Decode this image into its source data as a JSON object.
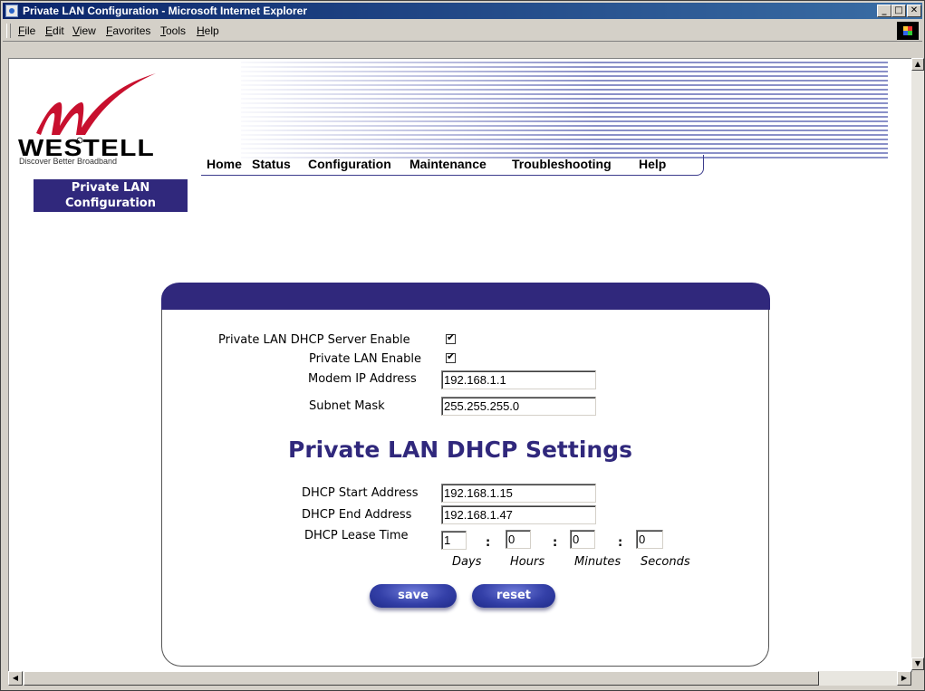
{
  "window": {
    "title": "Private LAN Configuration - Microsoft Internet Explorer",
    "controls": {
      "minimize": "_",
      "maximize": "□",
      "close": "✕"
    }
  },
  "menu": {
    "file": "File",
    "edit": "Edit",
    "view": "View",
    "favorites": "Favorites",
    "tools": "Tools",
    "help": "Help"
  },
  "header": {
    "brand": "WESTELL",
    "tagline": "Discover Better Broadband",
    "section_line1": "Private LAN",
    "section_line2": "Configuration"
  },
  "nav": [
    "Home",
    "Status",
    "Configuration",
    "Maintenance",
    "Troubleshooting",
    "Help"
  ],
  "form": {
    "dhcp_server_enable_label": "Private LAN DHCP Server Enable",
    "dhcp_server_enable_checked": true,
    "lan_enable_label": "Private LAN Enable",
    "lan_enable_checked": true,
    "modem_ip_label": "Modem IP Address",
    "modem_ip_value": "192.168.1.1",
    "subnet_label": "Subnet Mask",
    "subnet_value": "255.255.255.0",
    "dhcp_heading": "Private LAN DHCP Settings",
    "dhcp_start_label": "DHCP Start Address",
    "dhcp_start_value": "192.168.1.15",
    "dhcp_end_label": "DHCP End Address",
    "dhcp_end_value": "192.168.1.47",
    "lease_label": "DHCP Lease Time",
    "lease_days": "1",
    "lease_hours": "0",
    "lease_minutes": "0",
    "lease_seconds": "0",
    "unit_days": "Days",
    "unit_hours": "Hours",
    "unit_minutes": "Minutes",
    "unit_seconds": "Seconds",
    "save_label": "save",
    "reset_label": "reset"
  },
  "colors": {
    "accent": "#30287c",
    "titlebar": "#0a246a"
  },
  "icons": [
    "ie-window-icon",
    "windows-logo-icon",
    "westell-logo-icon",
    "checkmark-icon",
    "scroll-arrow-icon"
  ]
}
